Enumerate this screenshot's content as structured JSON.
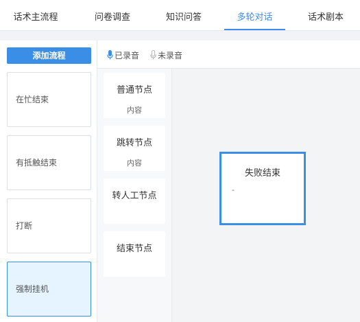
{
  "tabs": [
    {
      "label": "话术主流程",
      "active": false
    },
    {
      "label": "问卷调查",
      "active": false
    },
    {
      "label": "知识问答",
      "active": false
    },
    {
      "label": "多轮对话",
      "active": true
    },
    {
      "label": "话术剧本",
      "active": false
    }
  ],
  "sidebar": {
    "add_button_label": "添加流程",
    "flows": [
      {
        "label": "在忙结束",
        "selected": false
      },
      {
        "label": "有抵触结束",
        "selected": false
      },
      {
        "label": "打断",
        "selected": false
      },
      {
        "label": "强制挂机",
        "selected": true
      }
    ]
  },
  "toolbar": {
    "recorded_label": "已录音",
    "unrecorded_label": "未录音"
  },
  "palette": {
    "nodes": [
      {
        "title": "普通节点",
        "sub": "内容"
      },
      {
        "title": "跳转节点",
        "sub": "内容"
      },
      {
        "title": "转人工节点",
        "sub": ""
      },
      {
        "title": "结束节点",
        "sub": ""
      }
    ]
  },
  "canvas": {
    "node": {
      "title": "失败结束",
      "desc": "-"
    }
  },
  "colors": {
    "accent": "#3a8ee6",
    "recorded_icon": "#3a8ee6",
    "unrecorded_icon": "#b0b4ba",
    "selected_bg": "#e5f4ff"
  }
}
